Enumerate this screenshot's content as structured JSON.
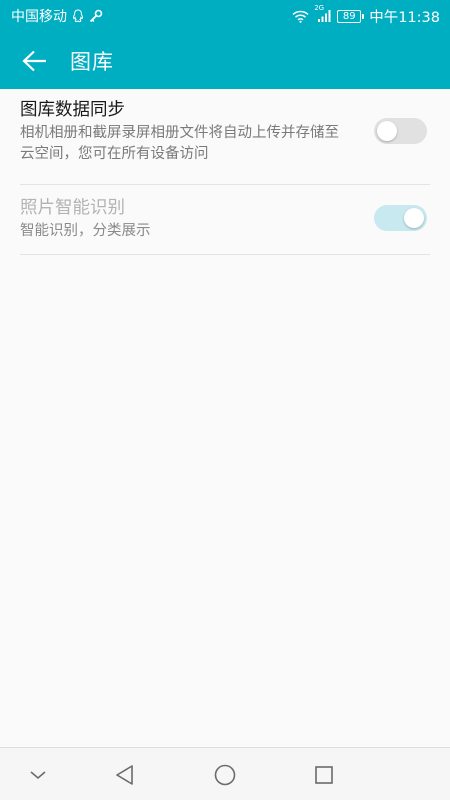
{
  "status_bar": {
    "carrier": "中国移动",
    "network": "2G",
    "battery": "89",
    "time": "中午11:38"
  },
  "app_bar": {
    "title": "图库"
  },
  "settings": [
    {
      "title": "图库数据同步",
      "description": "相机相册和截屏录屏相册文件将自动上传并存储至云空间，您可在所有设备访问",
      "enabled": false,
      "disabled": false
    },
    {
      "title": "照片智能识别",
      "description": "智能识别，分类展示",
      "enabled": true,
      "disabled": true
    }
  ],
  "colors": {
    "accent": "#00aec2",
    "toggle_off_track": "#e1e1e1",
    "toggle_on_disabled_track": "#c7e9ef"
  },
  "icons": {
    "back": "arrow-left-icon",
    "nav_hide": "chevron-down-icon",
    "nav_back": "triangle-back-icon",
    "nav_home": "circle-home-icon",
    "nav_recents": "square-recents-icon"
  }
}
